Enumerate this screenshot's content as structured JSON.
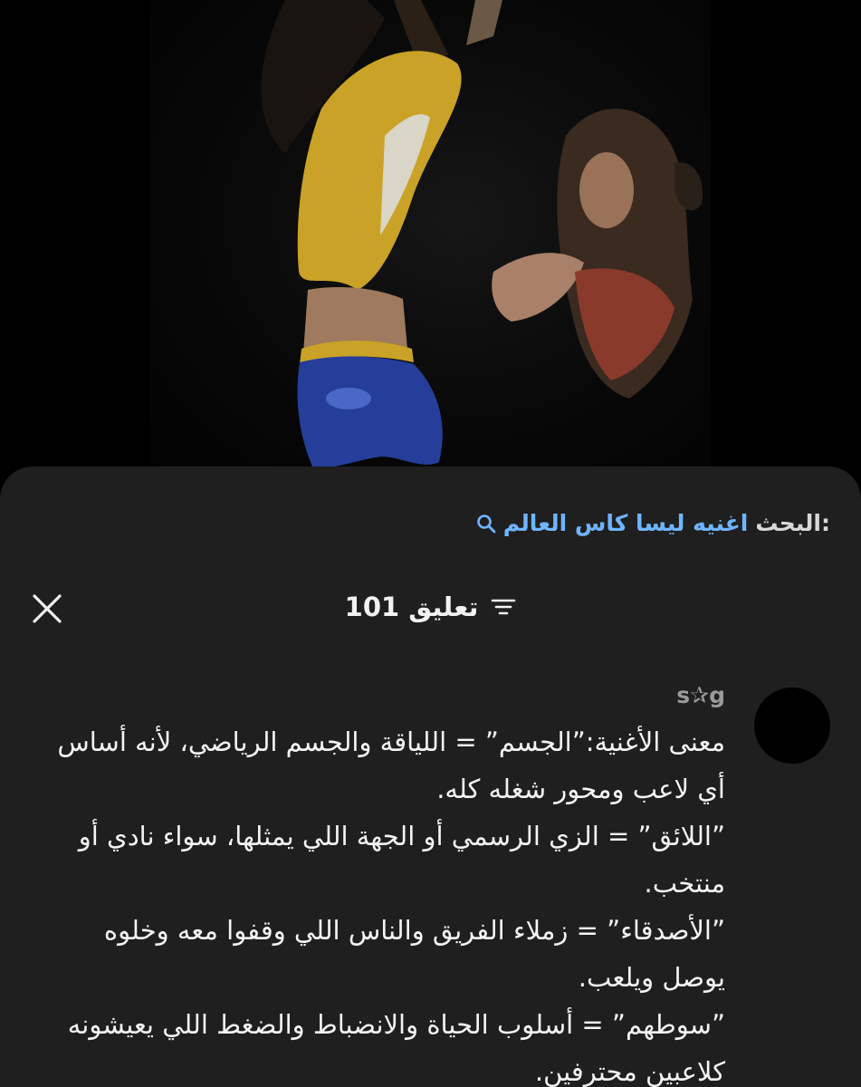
{
  "video": {
    "description_icon": "video-frame"
  },
  "search": {
    "prefix": "البحث:",
    "query": "اغنيه ليسا كاس العالم",
    "icon": "search-icon"
  },
  "header": {
    "title": "101 تعليق",
    "filter_icon": "filter-icon",
    "close_icon": "close-icon"
  },
  "comment": {
    "username": "s✰g",
    "lines": [
      "معنى الأغنية:”الجسم” = اللياقة والجسم الرياضي، لأنه أساس أي لاعب ومحور شغله كله.",
      "”اللائق” = الزي الرسمي أو الجهة اللي يمثلها، سواء نادي أو منتخب.",
      "”الأصدقاء” = زملاء الفريق والناس اللي وقفوا معه وخلوه يوصل ويلعب.",
      "”سوطهم” = أسلوب الحياة والانضباط والضغط اللي يعيشونه كلاعبين محترفين."
    ]
  },
  "colors": {
    "sheet_bg": "#1f1f1f",
    "link": "#6fb5ff",
    "text": "#f4f4f4",
    "muted": "#9a9a9a"
  }
}
